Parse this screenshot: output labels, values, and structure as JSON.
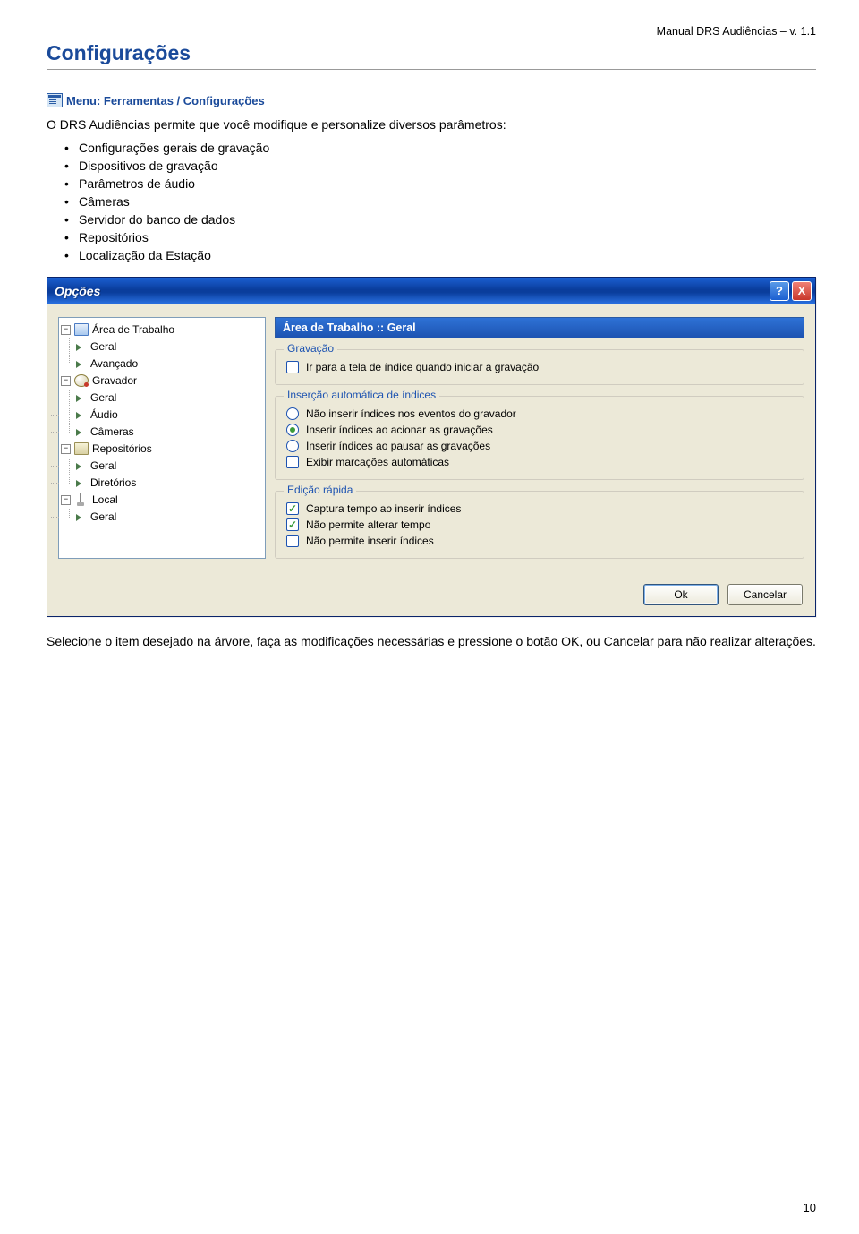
{
  "header": {
    "doc_title": "Manual DRS Audiências – v. 1.1"
  },
  "section_title": "Configurações",
  "menu_path": "Menu: Ferramentas / Configurações",
  "intro": "O DRS Audiências permite que você modifique e personalize diversos parâmetros:",
  "bullets": [
    "Configurações gerais de gravação",
    "Dispositivos de gravação",
    "Parâmetros de áudio",
    "Câmeras",
    "Servidor do banco de dados",
    "Repositórios",
    "Localização da Estação"
  ],
  "dialog": {
    "title": "Opções",
    "help_symbol": "?",
    "close_symbol": "X",
    "panel_heading": "Área de Trabalho :: Geral",
    "tree": {
      "workspace": {
        "label": "Área de Trabalho",
        "children": [
          "Geral",
          "Avançado"
        ]
      },
      "recorder": {
        "label": "Gravador",
        "children": [
          "Geral",
          "Áudio",
          "Câmeras"
        ]
      },
      "repos": {
        "label": "Repositórios",
        "children": [
          "Geral",
          "Diretórios"
        ]
      },
      "local": {
        "label": "Local",
        "children": [
          "Geral"
        ]
      }
    },
    "group_gravacao": {
      "title": "Gravação",
      "opt1": "Ir para a tela de índice quando iniciar a gravação"
    },
    "group_insercao": {
      "title": "Inserção automática de índices",
      "opt1": "Não inserir índices nos eventos do gravador",
      "opt2": "Inserir índices ao acionar as gravações",
      "opt3": "Inserir índices ao pausar as gravações",
      "opt4": "Exibir marcações automáticas"
    },
    "group_edicao": {
      "title": "Edição rápida",
      "opt1": "Captura tempo ao inserir índices",
      "opt2": "Não permite alterar tempo",
      "opt3": "Não permite inserir índices"
    },
    "buttons": {
      "ok": "Ok",
      "cancel": "Cancelar"
    }
  },
  "below": "Selecione o item desejado na árvore, faça as modificações necessárias e pressione o botão OK, ou Cancelar para não realizar alterações.",
  "page_number": "10"
}
